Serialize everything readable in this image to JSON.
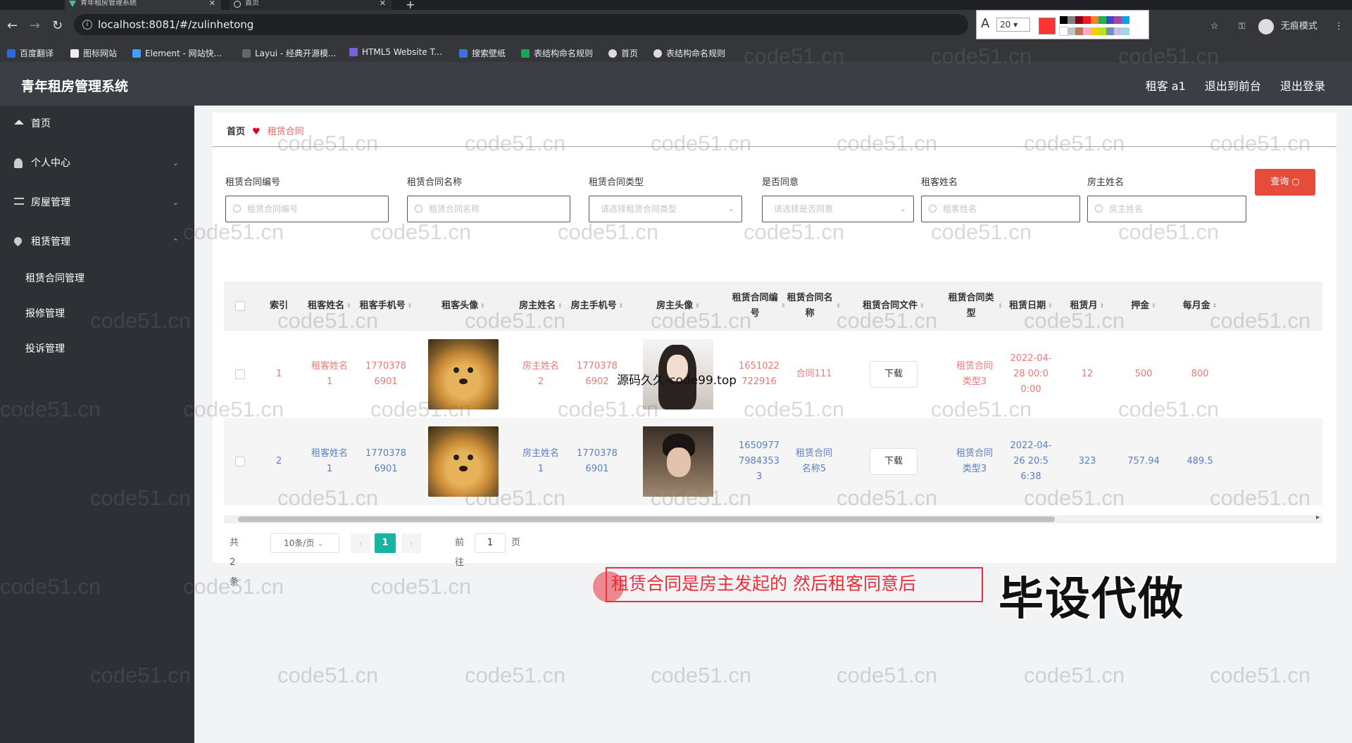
{
  "browser": {
    "tabs": [
      {
        "title": "青年租房管理系统"
      },
      {
        "title": "首页"
      }
    ],
    "url": "localhost:8081/#/zulinhetong",
    "font_size": "20",
    "profile_label": "无痕模式",
    "bookmarks": [
      "百度翻译",
      "图标网站",
      "Element - 网站快...",
      "Layui - 经典开源模...",
      "HTML5 Website T...",
      "搜索壁纸",
      "表结构命名规则",
      "首页",
      "表结构命名规则"
    ]
  },
  "header": {
    "title": "青年租房管理系统",
    "user": "租客 a1",
    "front": "退出到前台",
    "logout": "退出登录"
  },
  "sidebar": {
    "items": [
      {
        "label": "首页",
        "icon": "home-icon"
      },
      {
        "label": "个人中心",
        "icon": "user-icon"
      },
      {
        "label": "房屋管理",
        "icon": "list-icon"
      },
      {
        "label": "租赁管理",
        "icon": "location-icon"
      }
    ],
    "subitems": [
      "租赁合同管理",
      "报修管理",
      "投诉管理"
    ]
  },
  "breadcrumb": {
    "home": "首页",
    "current": "租赁合同"
  },
  "filters": [
    {
      "label": "租赁合同编号",
      "placeholder": "租赁合同编号"
    },
    {
      "label": "租赁合同名称",
      "placeholder": "租赁合同名称"
    },
    {
      "label": "租赁合同类型",
      "placeholder": "请选择租赁合同类型"
    },
    {
      "label": "是否同意",
      "placeholder": "请选择是否同意"
    },
    {
      "label": "租客姓名",
      "placeholder": "租客姓名"
    },
    {
      "label": "房主姓名",
      "placeholder": "房主姓名"
    }
  ],
  "query_button": "查询",
  "table": {
    "headers": [
      "索引",
      "租客姓名",
      "租客手机号",
      "租客头像",
      "房主姓名",
      "房主手机号",
      "房主头像",
      "租赁合同编号",
      "租赁合同名称",
      "租赁合同文件",
      "租赁合同类型",
      "租赁日期",
      "租赁月",
      "押金",
      "每月金"
    ],
    "rows": [
      {
        "index": "1",
        "tenant_name": "租客姓名1",
        "tenant_phone": "17703786901",
        "landlord_name": "房主姓名2",
        "landlord_phone": "17703786902",
        "contract_no": "1651022722916",
        "contract_name": "合同111",
        "download": "下载",
        "contract_type": "租赁合同类型3",
        "date": "2022-04-28 00:00:00",
        "months": "12",
        "deposit": "500",
        "monthly": "800"
      },
      {
        "index": "2",
        "tenant_name": "租客姓名1",
        "tenant_phone": "17703786901",
        "landlord_name": "房主姓名1",
        "landlord_phone": "17703786901",
        "contract_no": "16509777984353 3",
        "contract_name": "租赁合同名称5",
        "download": "下载",
        "contract_type": "租赁合同类型3",
        "date": "2022-04-26 20:56:38",
        "months": "323",
        "deposit": "757.94",
        "monthly": "489.5"
      }
    ]
  },
  "pagination": {
    "total": "共 2 条",
    "size": "10条/页",
    "page": "1",
    "goto_label": "前往",
    "goto_value": "1",
    "page_unit": "页"
  },
  "overlays": {
    "watermark": "code51.cn",
    "source_mark": "源码久久-code99.top",
    "annotation": "租赁合同是房主发起的 然后租客同意后",
    "big_text": "毕设代做"
  }
}
